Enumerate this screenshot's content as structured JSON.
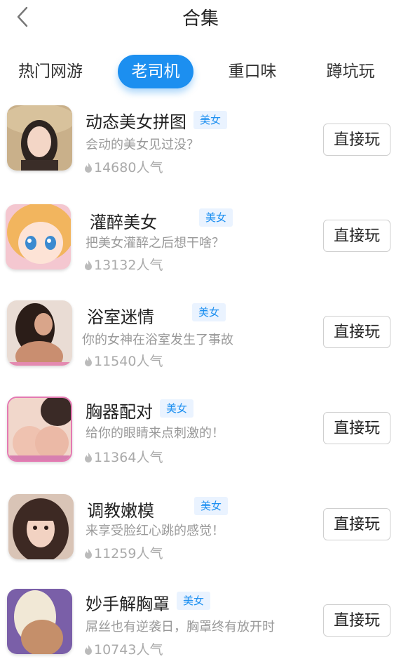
{
  "header": {
    "title": "合集",
    "back_icon": "chevron-left-icon"
  },
  "tabs": [
    {
      "label": "热门网游",
      "active": false
    },
    {
      "label": "老司机",
      "active": true
    },
    {
      "label": "重口味",
      "active": false
    },
    {
      "label": "蹲坑玩",
      "active": false
    }
  ],
  "colors": {
    "accent": "#1c8ff0",
    "tag_bg": "#eaf3ff",
    "muted_text": "#999999"
  },
  "games": [
    {
      "name": "动态美女拼图",
      "tag": "美女",
      "desc": "会动的美女见过没？",
      "players": "14680人气",
      "button": "直接玩"
    },
    {
      "name": "灌醉美女",
      "tag": "美女",
      "desc": "把美女灌醉之后想干啥？",
      "players": "13132人气",
      "button": "直接玩"
    },
    {
      "name": "浴室迷情",
      "tag": "美女",
      "desc": "你的女神在浴室发生了事故",
      "players": "11540人气",
      "button": "直接玩"
    },
    {
      "name": "胸器配对",
      "tag": "美女",
      "desc": "给你的眼睛来点刺激的！",
      "players": "11364人气",
      "button": "直接玩"
    },
    {
      "name": "调教嫩模",
      "tag": "美女",
      "desc": "来享受脸红心跳的感觉！",
      "players": "11259人气",
      "button": "直接玩"
    },
    {
      "name": "妙手解胸罩",
      "tag": "美女",
      "desc": "屌丝也有逆袭日，胸罩终有放开时",
      "players": "10743人气",
      "button": "直接玩"
    }
  ]
}
